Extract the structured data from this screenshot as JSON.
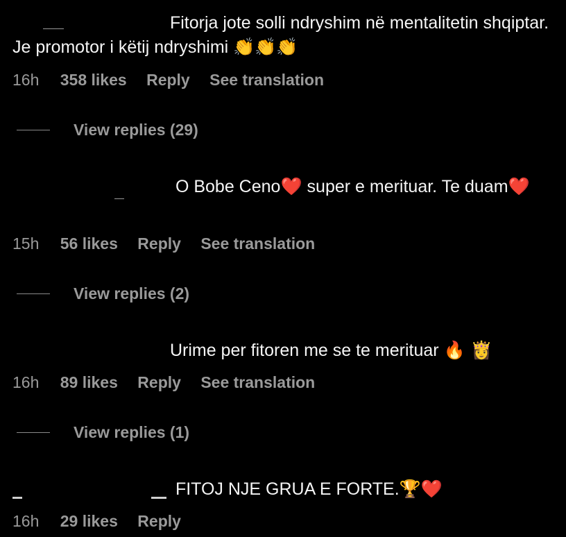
{
  "comments": [
    {
      "text": "Fitorja jote solli ndryshim në mentalitetin shqiptar. Je promotor i këtij ndryshimi",
      "emoji": "👏👏👏",
      "time": "16h",
      "likes": "358 likes",
      "reply": "Reply",
      "translate": "See translation",
      "view_replies": "View replies (29)"
    },
    {
      "text": "O Bobe Ceno",
      "emoji_mid": "❤️",
      "text2": "super e merituar. Te duam",
      "emoji": "❤️",
      "time": "15h",
      "likes": "56 likes",
      "reply": "Reply",
      "translate": "See translation",
      "view_replies": "View replies (2)"
    },
    {
      "text": "Urime per fitoren me se te merituar",
      "emoji": "🔥 👸",
      "time": "16h",
      "likes": "89 likes",
      "reply": "Reply",
      "translate": "See translation",
      "view_replies": "View replies (1)"
    },
    {
      "text": "FITOJ NJE GRUA E FORTE.",
      "emoji": "🏆❤️",
      "time": "16h",
      "likes": "29 likes",
      "reply": "Reply"
    }
  ]
}
